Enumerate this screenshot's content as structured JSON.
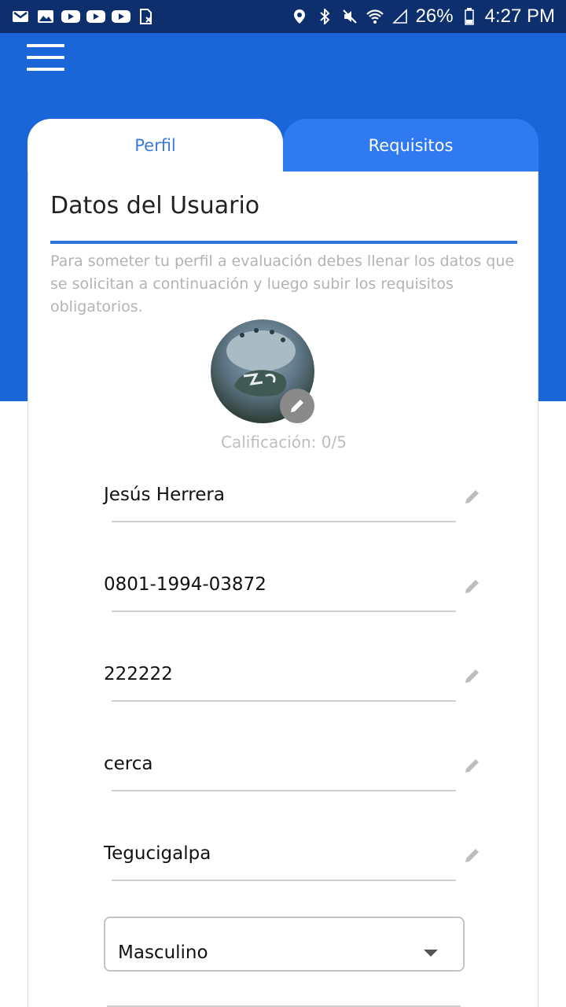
{
  "status_bar": {
    "battery": "26%",
    "time": "4:27 PM",
    "left_icons": [
      "gmail-icon",
      "gallery-icon",
      "youtube-icon",
      "youtube-icon",
      "youtube-icon",
      "no-sim-icon"
    ],
    "right_icons": [
      "location-icon",
      "bluetooth-icon",
      "mute-icon",
      "wifi-icon",
      "signal-icon",
      "battery-icon"
    ]
  },
  "colors": {
    "header": "#1a66d9",
    "status_bar": "#0d2f6e",
    "tab_active_text": "#3a7ae0",
    "tab_inactive_bg": "#2f7af0",
    "accent_rule": "#2f73d8"
  },
  "tabs": [
    {
      "label": "Perfil",
      "active": true
    },
    {
      "label": "Requisitos",
      "active": false
    }
  ],
  "card": {
    "title": "Datos del Usuario",
    "description": "Para someter tu perfil a evaluación debes llenar los datos que se solicitan a continuación y luego subir los requisitos obligatorios.",
    "rating": "Calificación: 0/5"
  },
  "fields": [
    {
      "value": "Jesús Herrera",
      "icon": "pencil-icon"
    },
    {
      "value": "0801-1994-03872",
      "icon": "pencil-icon"
    },
    {
      "value": "222222",
      "icon": "pencil-icon"
    },
    {
      "value": "cerca",
      "icon": "pencil-icon"
    },
    {
      "value": "Tegucigalpa",
      "icon": "pencil-icon"
    }
  ],
  "gender_select": {
    "value": "Masculino"
  }
}
